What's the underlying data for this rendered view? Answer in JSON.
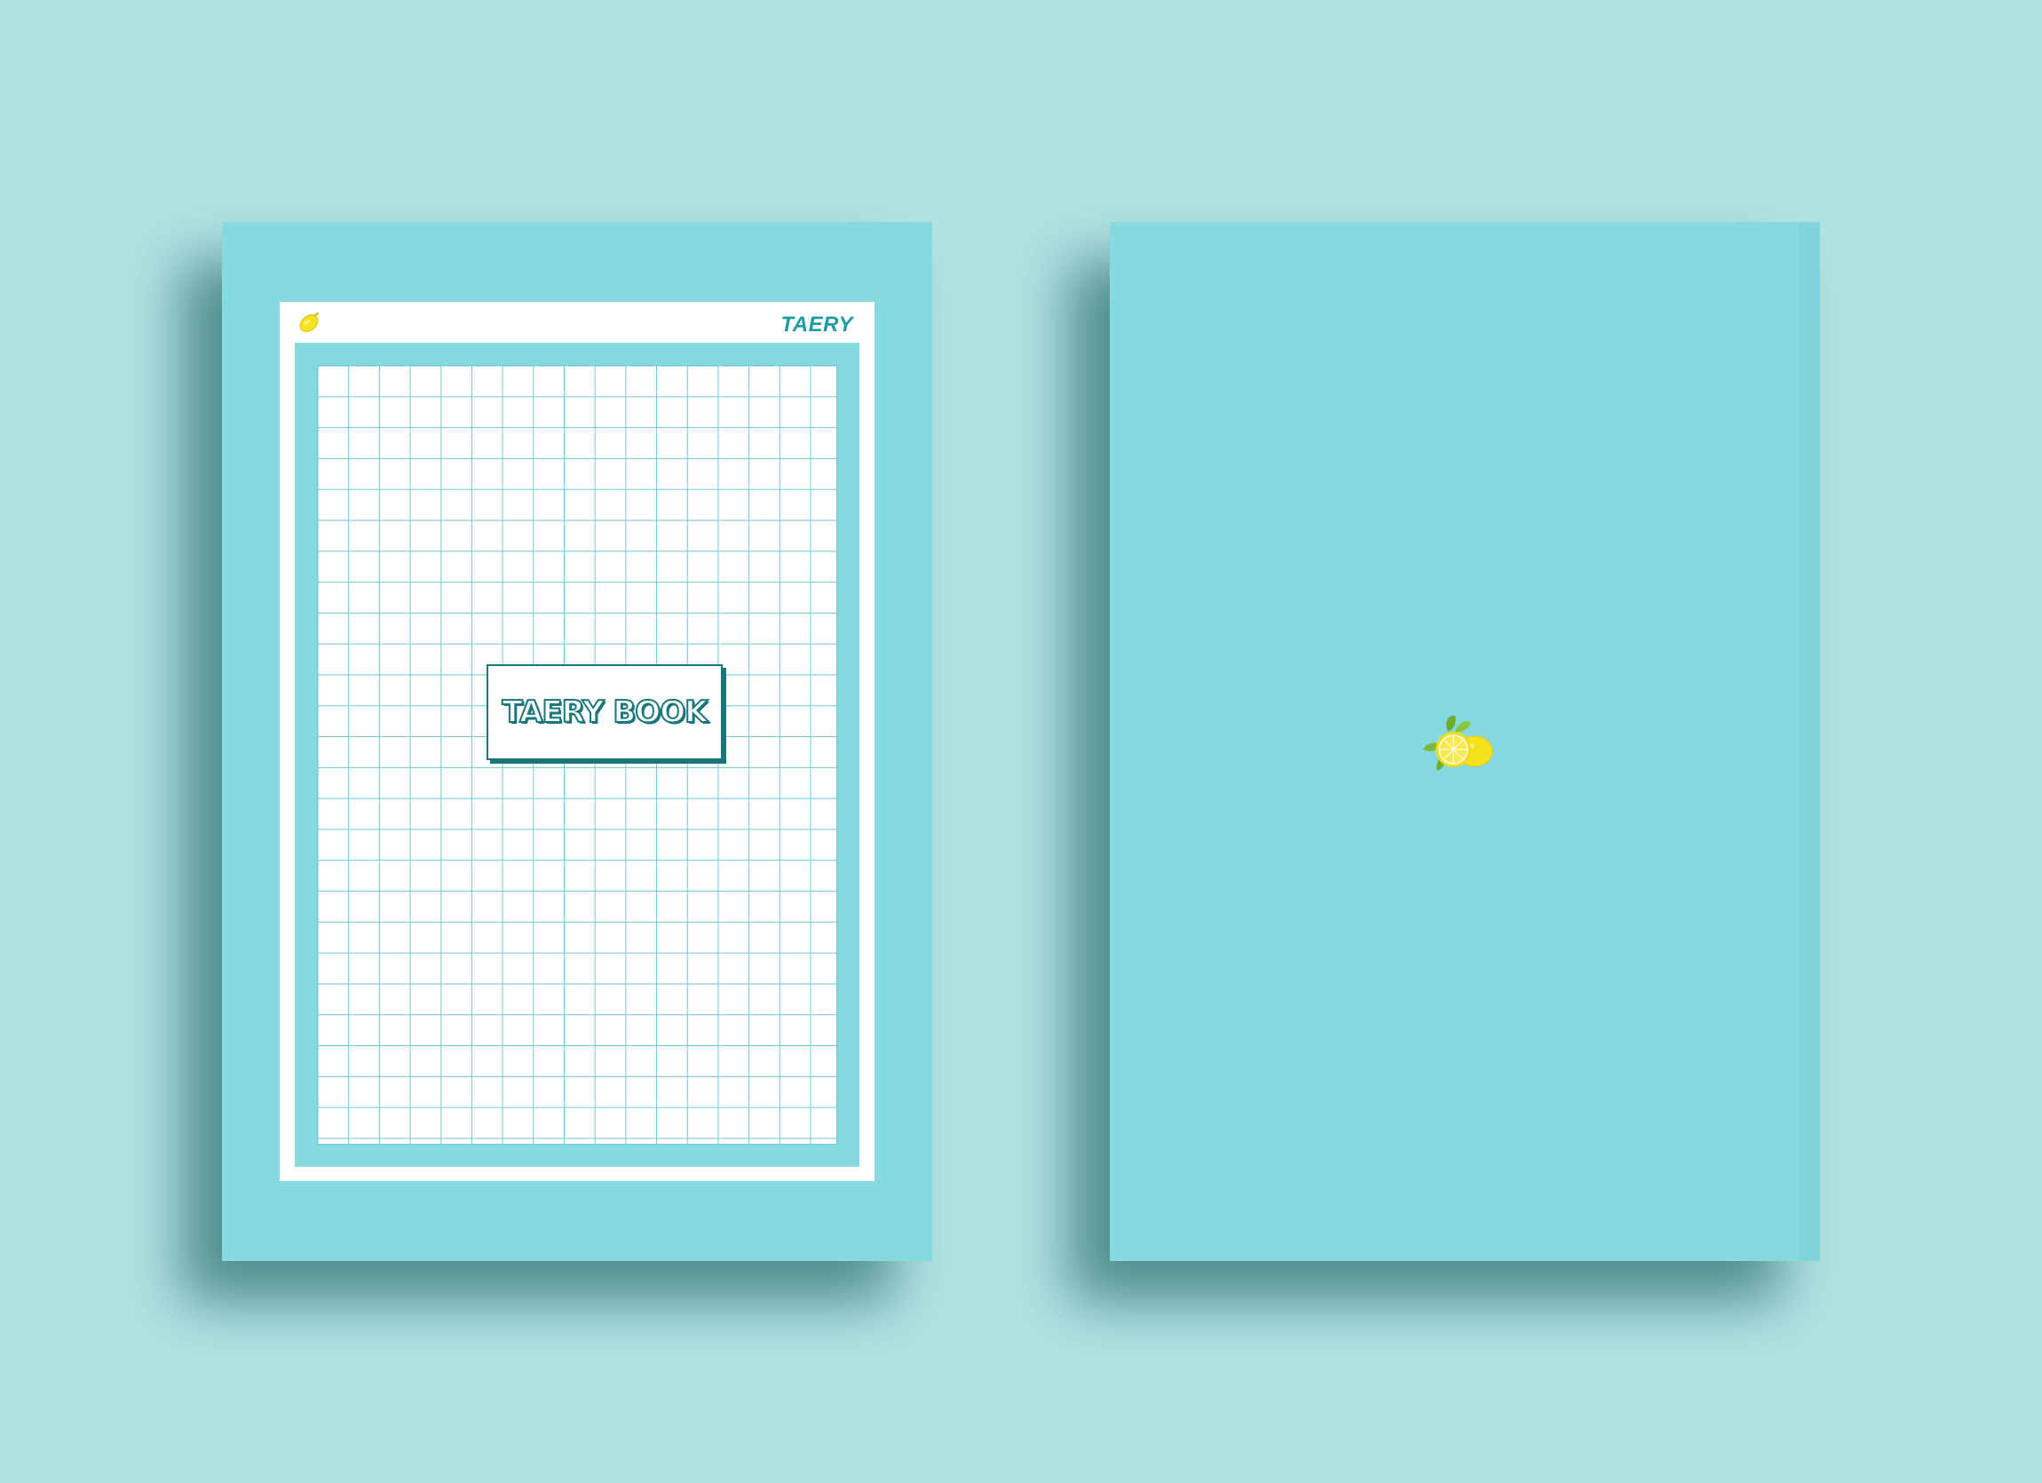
{
  "scene": {
    "background_color": "#b1e3e3",
    "cover_color": "#85d9df",
    "accent_color": "#17777b"
  },
  "front_cover": {
    "brand": "TAERY",
    "title": "TAERY BOOK",
    "corner_icon": "lemon-icon"
  },
  "back_cover": {
    "center_icon": "lemon-slice-icon"
  }
}
